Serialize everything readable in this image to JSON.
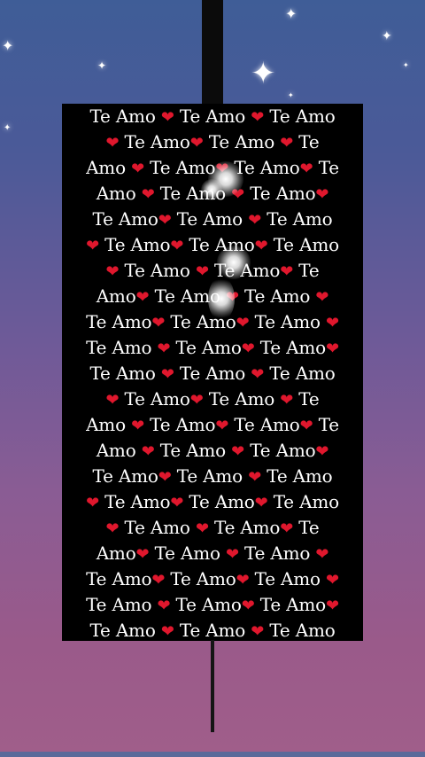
{
  "scene": {
    "phrase": "Te Amo",
    "heart_symbol": "❤",
    "heart_color": "#e0172d",
    "text_color": "#ffffff",
    "panel_color": "#000000"
  },
  "rows": [
    "Te Amo ❤ Te Amo ❤ Te Amo",
    "❤ Te Amo❤ Te Amo ❤ Te",
    "Amo ❤ Te Amo❤ Te Amo❤ Te",
    "Amo ❤ Te Amo ❤ Te Amo❤",
    "Te Amo❤ Te Amo ❤ Te Amo",
    "❤ Te Amo❤ Te Amo❤ Te Amo",
    "❤ Te Amo ❤ Te Amo❤ Te",
    "Amo❤ Te Amo ❤ Te Amo ❤",
    "Te Amo❤ Te Amo❤ Te Amo ❤",
    "Te Amo ❤ Te Amo❤ Te Amo❤",
    "Te Amo ❤ Te Amo ❤ Te Amo",
    "❤ Te Amo❤ Te Amo ❤ Te",
    "Amo ❤ Te Amo❤ Te Amo❤ Te",
    "Amo ❤ Te Amo ❤ Te Amo❤",
    "Te Amo❤ Te Amo ❤ Te Amo",
    "❤ Te Amo❤ Te Amo❤ Te Amo",
    "❤ Te Amo ❤ Te Amo❤ Te",
    "Amo❤ Te Amo ❤ Te Amo ❤",
    "Te Amo❤ Te Amo❤ Te Amo ❤",
    "Te Amo ❤ Te Amo❤ Te Amo❤",
    "Te Amo ❤ Te Amo ❤ Te Amo"
  ]
}
